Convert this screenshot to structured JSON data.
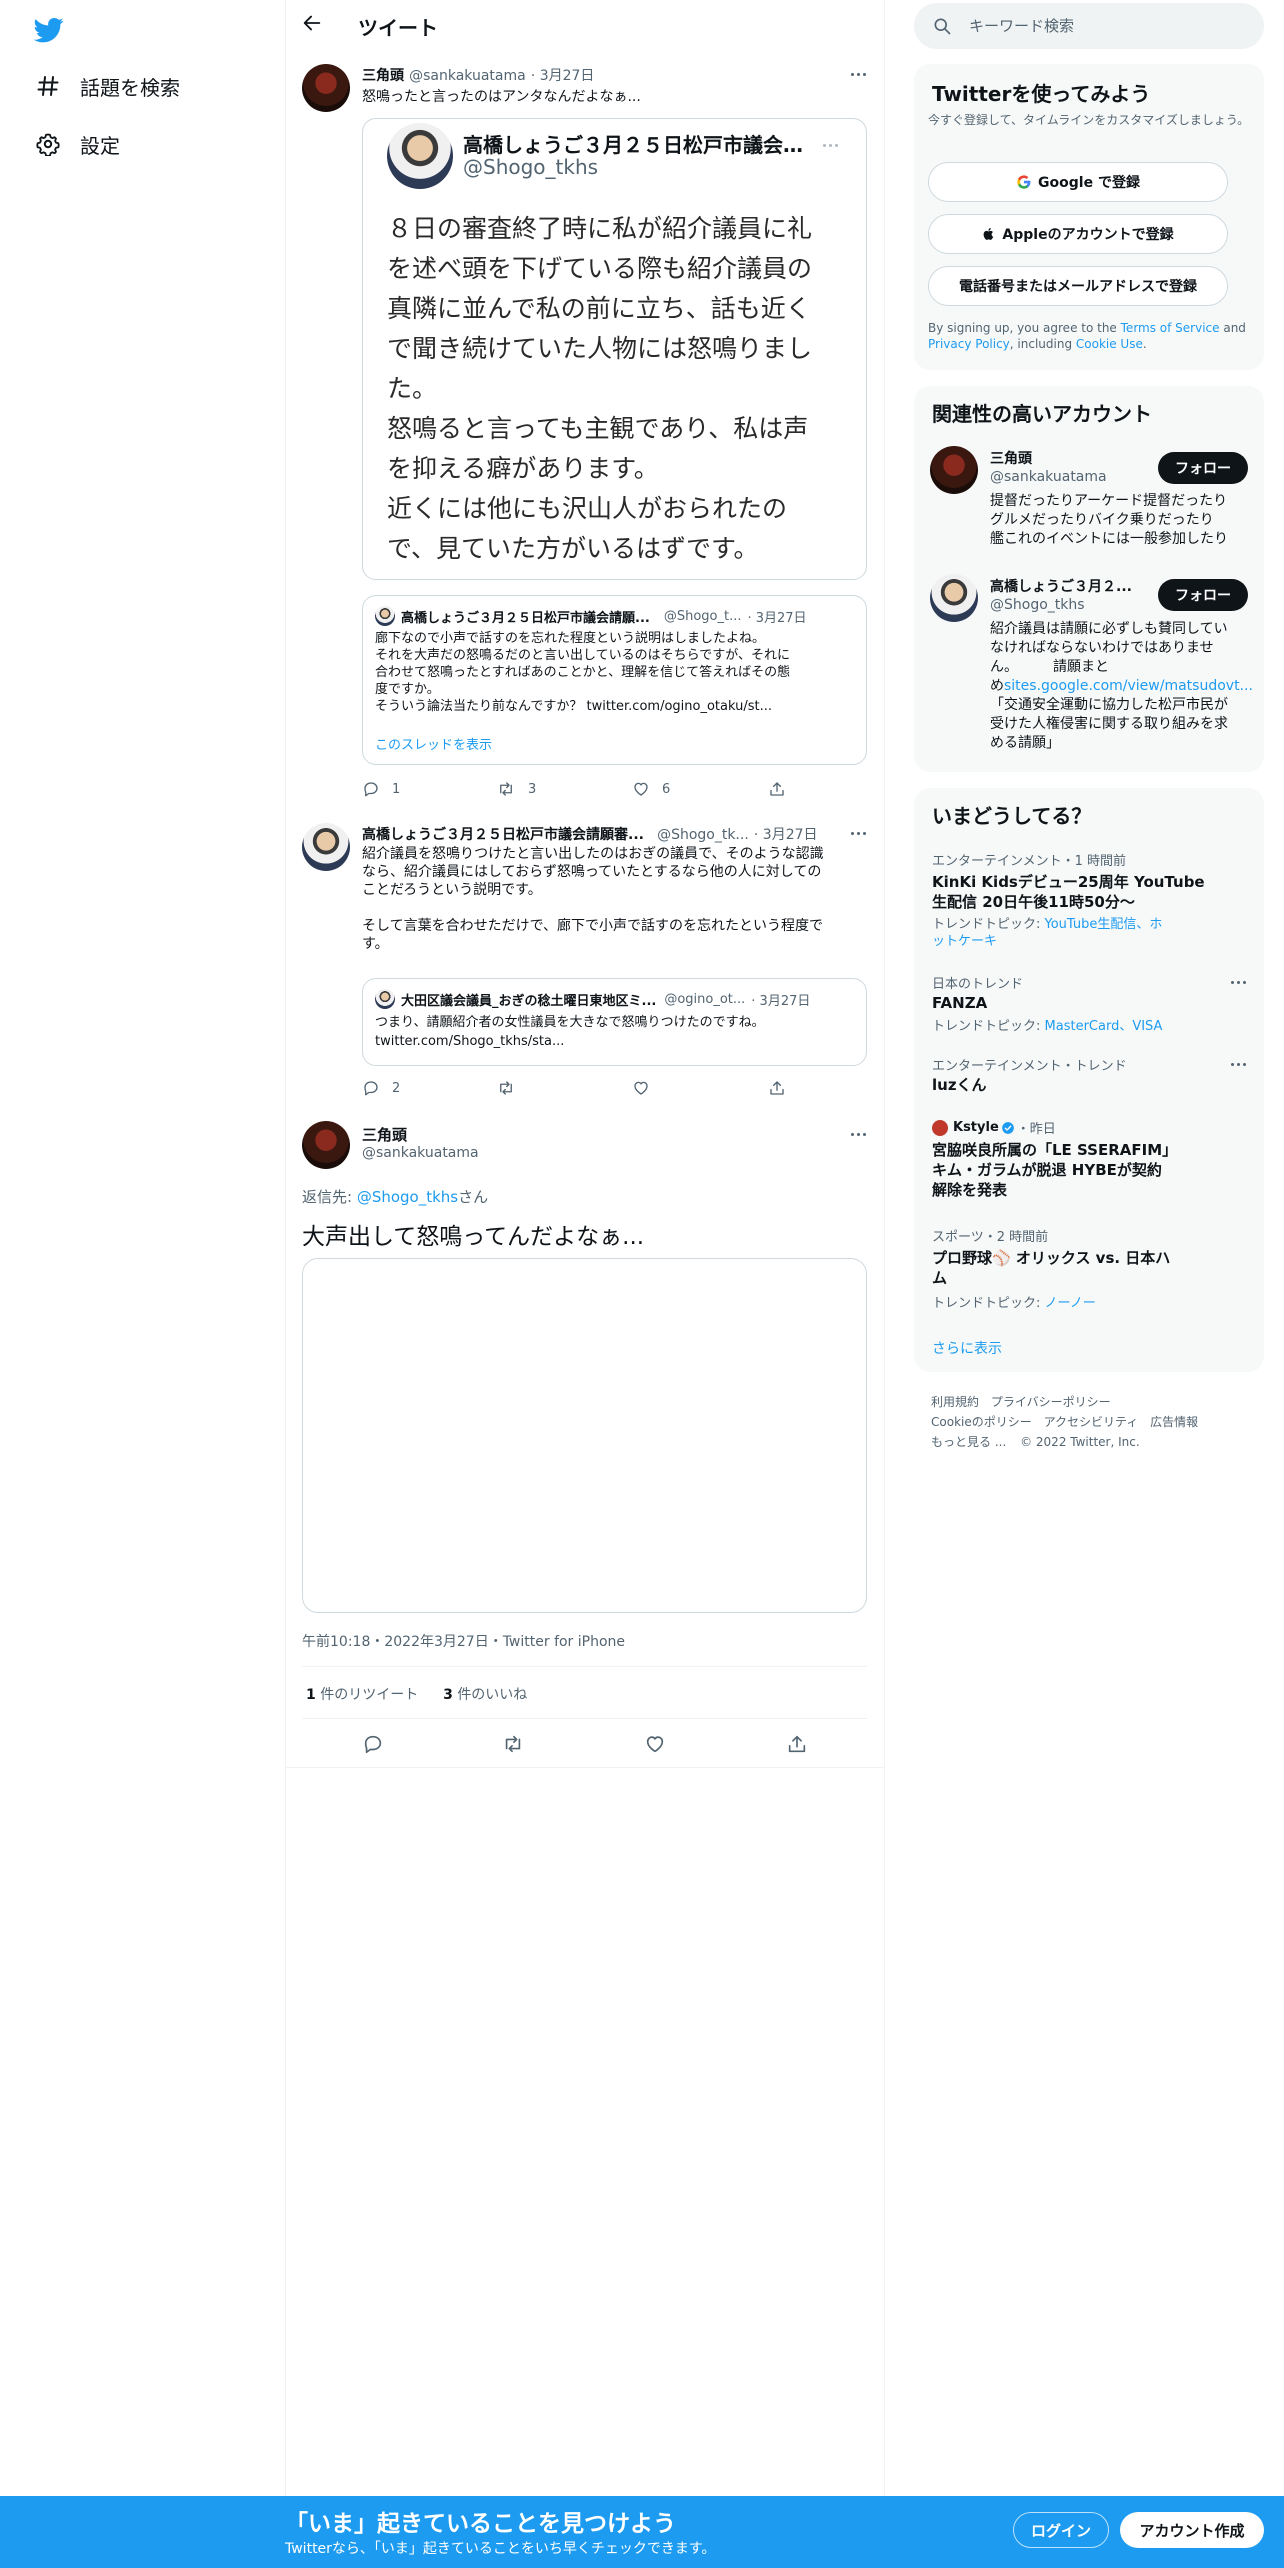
{
  "nav": {
    "explore_label": "話題を検索",
    "settings_label": "設定"
  },
  "header": {
    "title": "ツイート"
  },
  "tweet1": {
    "name": "三角頭",
    "handle": "@sankakuatama",
    "date": "· 3月27日",
    "text": "怒鳴ったと言ったのはアンタなんだよなぁ...",
    "quote_image": {
      "name": "高橋しょうご３月２５日松戸市議会請願…",
      "handle": "@Shogo_tkhs",
      "body_lines": [
        "８日の審査終了時に私が紹介議員に礼",
        "を述べ頭を下げている際も紹介議員の",
        "真隣に並んで私の前に立ち、話も近く",
        "で聞き続けていた人物には怒鳴りまし",
        "た。",
        "怒鳴ると言っても主観であり、私は声",
        "を抑える癖があります。",
        "近くには他にも沢山人がおられたの",
        "で、見ていた方がいるはずです。"
      ]
    },
    "quote": {
      "name": "高橋しょうご３月２５日松戸市議会請願...",
      "handle": "@Shogo_t...",
      "date": "· 3月27日",
      "lines": [
        "廊下なので小声で話すのを忘れた程度という説明はしましたよね。",
        "それを大声だの怒鳴るだのと言い出しているのはそちらですが、それに",
        "合わせて怒鳴ったとすればあのことかと、理解を信じて答えればその態",
        "度ですか。",
        "そういう論法当たり前なんですか？ twitter.com/ogino_otaku/st..."
      ],
      "show_thread": "このスレッドを表示"
    },
    "replies": "1",
    "retweets": "3",
    "likes": "6"
  },
  "tweet2": {
    "name": "高橋しょうご３月２５日松戸市議会請願審...",
    "handle": "@Shogo_tk...",
    "date": "· 3月27日",
    "lines": [
      "紹介議員を怒鳴りつけたと言い出したのはおぎの議員で、そのような認識",
      "なら、紹介議員にはしておらず怒鳴っていたとするなら他の人に対しての",
      "ことだろうという説明です。",
      "",
      "そして言葉を合わせただけで、廊下で小声で話すのを忘れたという程度で",
      "す。"
    ],
    "quote": {
      "name": "大田区議会議員_おぎの稔土曜日東地区ミ...",
      "handle": "@ogino_ot...",
      "date": "· 3月27日",
      "lines": [
        "つまり、請願紹介者の女性議員を大きなで怒鳴りつけたのですね。",
        "twitter.com/Shogo_tkhs/sta..."
      ]
    },
    "replies": "2"
  },
  "main_tweet": {
    "name": "三角頭",
    "handle": "@sankakuatama",
    "reply_prefix": "返信先: ",
    "reply_to": "@Shogo_tkhs",
    "reply_suffix": "さん",
    "text": "大声出して怒鳴ってんだよなぁ...",
    "timestamp": "午前10:18・2022年3月27日・Twitter for iPhone",
    "retweet_count": "1",
    "retweet_label": "件のリツイート",
    "like_count": "3",
    "like_label": "件のいいね"
  },
  "search": {
    "placeholder": "キーワード検索"
  },
  "signup_panel": {
    "title": "Twitterを使ってみよう",
    "subtitle": "今すぐ登録して、タイムラインをカスタマイズしましょう。",
    "google_btn": "Google で登録",
    "apple_btn": "Appleのアカウントで登録",
    "phone_btn": "電話番号またはメールアドレスで登録",
    "terms_1": "By signing up, you agree to the ",
    "terms_link1": "Terms of Service",
    "terms_2": " and",
    "terms_link2": "Privacy Policy",
    "terms_3": ", including ",
    "terms_link3": "Cookie Use",
    "terms_4": "."
  },
  "related_panel": {
    "title": "関連性の高いアカウント",
    "follow_label": "フォロー",
    "accounts": [
      {
        "name": "三角頭",
        "handle": "@sankakuatama",
        "bio": [
          "提督だったりアーケード提督だったり",
          "グルメだったりバイク乗りだったり",
          "艦これのイベントには一般参加したり"
        ]
      },
      {
        "name": "高橋しょうご３月２...",
        "handle": "@Shogo_tkhs",
        "bio": [
          "紹介議員は請願に必ずしも賛同してい",
          "なければならないわけではありませ",
          "ん。　　　請願まと"
        ],
        "bio_link_prefix": "め",
        "bio_link": "sites.google.com/view/matsudovt...",
        "bio_rest": [
          "「交通安全運動に協力した松戸市民が",
          "受けた人権侵害に関する取り組みを求",
          "める請願」"
        ]
      }
    ]
  },
  "trends_panel": {
    "title": "いまどうしてる？",
    "trends": [
      {
        "meta": "エンターテインメント・1 時間前",
        "title": [
          "KinKi Kidsデビュー25周年 YouTube",
          "生配信 20日午後11時50分〜"
        ],
        "topic_prefix": "トレンドトピック: ",
        "topics": "YouTube生配信、ホ",
        "topics2": "ットケーキ"
      },
      {
        "meta": "日本のトレンド",
        "title": [
          "FANZA"
        ],
        "topic_prefix": "トレンドトピック: ",
        "topics": "MasterCard、VISA"
      },
      {
        "meta": "エンターテインメント・トレンド",
        "title": [
          "luzくん"
        ]
      },
      {
        "source": "Kstyle",
        "source_time": "・昨日",
        "title": [
          "宮脇咲良所属の「LE SSERAFIM」",
          "キム・ガラムが脱退 HYBEが契約",
          "解除を発表"
        ]
      },
      {
        "meta": "スポーツ・2 時間前",
        "title": [
          "プロ野球⚾ オリックス vs. 日本ハ",
          "ム"
        ],
        "topic_prefix": "トレンドトピック: ",
        "topics": "ノーノー"
      }
    ],
    "show_more": "さらに表示"
  },
  "footer": {
    "links_row1": [
      "利用規約",
      "プライバシーポリシー"
    ],
    "links_row2": [
      "Cookieのポリシー",
      "アクセシビリティ",
      "広告情報"
    ],
    "more": "もっと見る ...",
    "copyright": "© 2022 Twitter, Inc."
  },
  "bottom_bar": {
    "title": "「いま」起きていることを見つけよう",
    "subtitle": "Twitterなら、「いま」起きていることをいち早くチェックできます。",
    "login": "ログイン",
    "signup": "アカウント作成"
  },
  "colors": {
    "accent": "#1d9bf0",
    "text": "#0f1419",
    "secondary": "#536471",
    "border": "#cfd9de"
  }
}
